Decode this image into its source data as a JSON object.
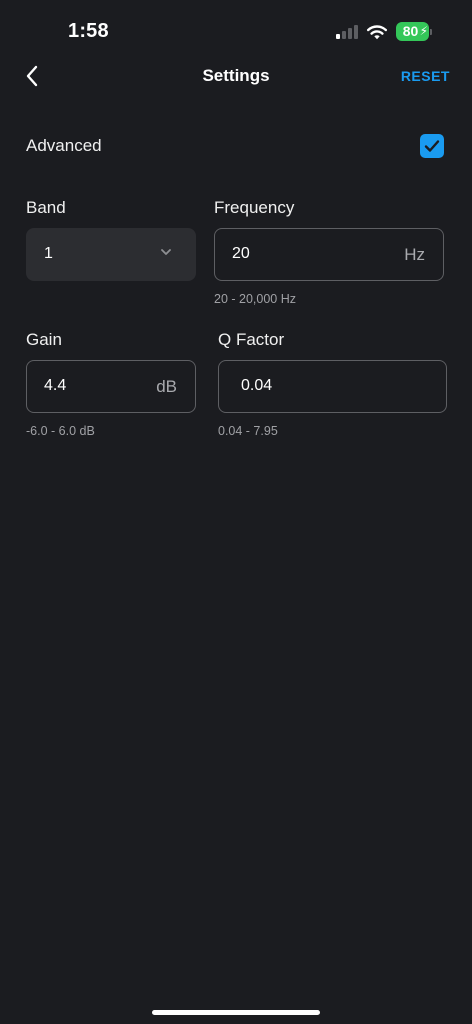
{
  "status_bar": {
    "time": "1:58",
    "battery": "80"
  },
  "nav": {
    "title": "Settings",
    "reset_label": "RESET"
  },
  "advanced": {
    "label": "Advanced",
    "checked": true
  },
  "band": {
    "label": "Band",
    "value": "1"
  },
  "frequency": {
    "label": "Frequency",
    "value": "20",
    "unit": "Hz",
    "range": "20 - 20,000 Hz"
  },
  "gain": {
    "label": "Gain",
    "value": "4.4",
    "unit": "dB",
    "range": "-6.0 - 6.0 dB"
  },
  "q_factor": {
    "label": "Q Factor",
    "value": "0.04",
    "range": "0.04 - 7.95"
  },
  "colors": {
    "background": "#1b1c20",
    "accent": "#1a9bf0",
    "battery": "#34c759"
  }
}
